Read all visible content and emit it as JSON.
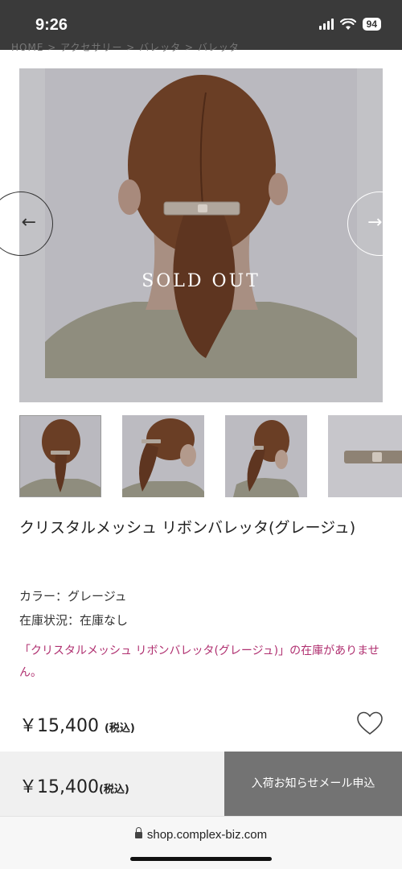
{
  "status_bar": {
    "time": "9:26",
    "battery": "94"
  },
  "breadcrumb": "HOME  >  アクセサリー  >  バレッタ  >  バレッタ",
  "gallery": {
    "badge": "SOLD OUT",
    "prev_arrow": "←",
    "next_arrow": "→",
    "thumbnail_count": 4
  },
  "product": {
    "title": "クリスタルメッシュ リボンバレッタ(グレージュ)",
    "color_label": "カラー：",
    "color_value": "グレージュ",
    "stock_label": "在庫状況：",
    "stock_value": "在庫なし",
    "stock_notice": "「クリスタルメッシュ リボンバレッタ(グレージュ)」の在庫がありません。",
    "price": "￥15,400",
    "tax_note": "(税込)"
  },
  "bottom_bar": {
    "price": "￥15,400",
    "tax_note": "(税込)",
    "notify_button": "入荷お知らせメール申込"
  },
  "browser": {
    "url": "shop.complex-biz.com"
  },
  "icons": {
    "favorite": "heart-icon",
    "secure": "lock-icon"
  }
}
